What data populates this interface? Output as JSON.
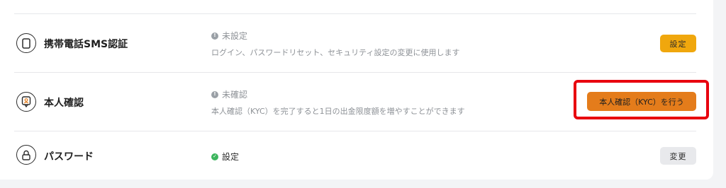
{
  "rows": [
    {
      "title": "携帯電話SMS認証",
      "icon": "phone-icon",
      "status": "未設定",
      "status_icon": "info-dot-icon",
      "description": "ログイン、パスワードリセット、セキュリティ設定の変更に使用します",
      "button_label": "設定",
      "button_color": "#f0a70d"
    },
    {
      "title": "本人確認",
      "icon": "id-badge-icon",
      "status": "未確認",
      "status_icon": "info-dot-icon",
      "description": "本人確認（KYC）を完了すると1日の出金限度額を増やすことができます",
      "button_label": "本人確認（KYC）を行う",
      "button_color": "#e47c1b"
    },
    {
      "title": "パスワード",
      "icon": "lock-icon",
      "status": "設定",
      "status_icon": "check-dot-icon",
      "button_label": "変更",
      "button_color": "#e8e9ec"
    }
  ],
  "colors": {
    "highlight_border": "#e8000e",
    "status_ok": "#3cb55d",
    "status_pending": "#9aa0a6"
  }
}
